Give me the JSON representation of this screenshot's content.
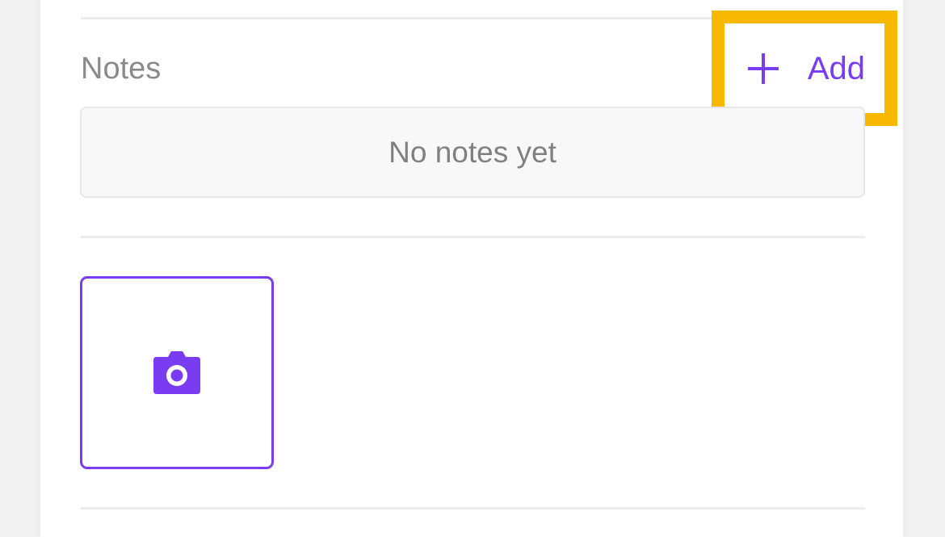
{
  "notes": {
    "title": "Notes",
    "add_label": "Add",
    "empty_message": "No notes yet"
  },
  "photo": {
    "icon": "camera-icon"
  },
  "colors": {
    "accent": "#7a3cf0",
    "highlight": "#f8b800",
    "muted_text": "#8a8a8e"
  }
}
